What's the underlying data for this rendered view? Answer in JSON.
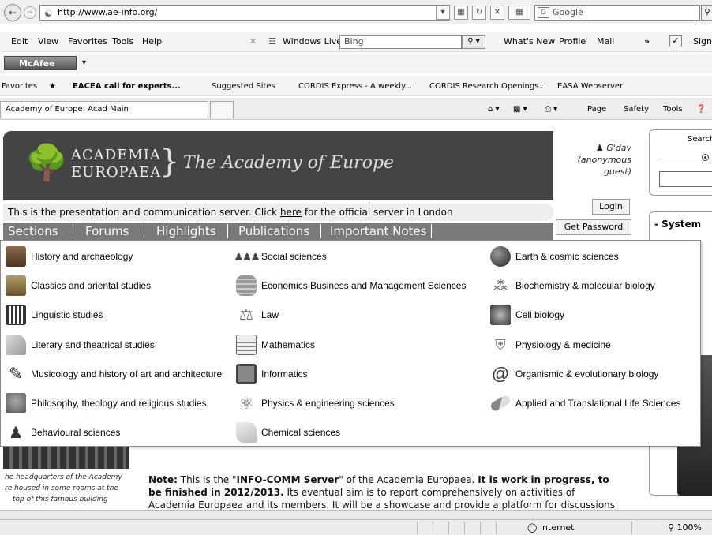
{
  "browser": {
    "url": "http://www.ae-info.org/",
    "search_engine": "Google",
    "menu": [
      "Edit",
      "View",
      "Favorites",
      "Tools",
      "Help"
    ],
    "windows_live": "Windows Live",
    "wl_search_placeholder": "Bing",
    "whats_new": "What's New",
    "profile": "Profile",
    "mail": "Mail",
    "sign": "Sign",
    "mcafee": "McAfee",
    "favorites_label": "Favorites",
    "favorites": [
      "EACEA call for experts...",
      "Suggested Sites",
      "CORDIS Express - A weekly...",
      "CORDIS Research Openings...",
      "EASA Webserver"
    ],
    "tab_title": "Academy of Europe: Acad Main",
    "command_bar": [
      "Page",
      "Safety",
      "Tools"
    ]
  },
  "site": {
    "logo_line1": "ACADEMIA",
    "logo_line2": "EUROPAEA",
    "tagline": "The Academy of Europe",
    "info_text_pre": "This is the presentation and communication server. Click ",
    "info_link": "here",
    "info_text_post": " for the official server in London",
    "sections": [
      "Sections",
      "Forums",
      "Highlights",
      "Publications",
      "Important Notes"
    ],
    "greeting": "G'day (anonymous guest)",
    "login": "Login",
    "get_password": "Get Password",
    "search_label": "Search",
    "system_title": "- System"
  },
  "dropdown": {
    "col1": [
      {
        "label": "History and archaeology",
        "icon": "ruins-icon"
      },
      {
        "label": "Classics and oriental studies",
        "icon": "statue-icon"
      },
      {
        "label": "Linguistic studies",
        "icon": "script-icon"
      },
      {
        "label": "Literary and theatrical studies",
        "icon": "book-icon"
      },
      {
        "label": "Musicology and history of art and architecture",
        "icon": "brush-icon"
      },
      {
        "label": "Philosophy, theology and religious studies",
        "icon": "thinker-icon"
      },
      {
        "label": "Behavioural sciences",
        "icon": "person-icon"
      }
    ],
    "col2": [
      {
        "label": "Social sciences",
        "icon": "crowd-icon"
      },
      {
        "label": "Economics Business and Management Sciences",
        "icon": "coins-icon"
      },
      {
        "label": "Law",
        "icon": "scales-icon"
      },
      {
        "label": "Mathematics",
        "icon": "calculator-icon"
      },
      {
        "label": "Informatics",
        "icon": "computer-icon"
      },
      {
        "label": "Physics & engineering sciences",
        "icon": "atom-icon"
      },
      {
        "label": "Chemical sciences",
        "icon": "flask-icon"
      }
    ],
    "col3": [
      {
        "label": "Earth & cosmic sciences",
        "icon": "globe-icon"
      },
      {
        "label": "Biochemistry & molecular biology",
        "icon": "molecule-icon"
      },
      {
        "label": "Cell biology",
        "icon": "cell-icon"
      },
      {
        "label": "Physiology & medicine",
        "icon": "shield-icon"
      },
      {
        "label": "Organismic & evolutionary biology",
        "icon": "snail-icon"
      },
      {
        "label": "Applied and Translational Life Sciences",
        "icon": "pill-icon"
      }
    ]
  },
  "bottom": {
    "caption1": "he headquarters of the Academy",
    "caption2": "re housed in some rooms at the",
    "caption3": "top of this famous building",
    "note_label": "Note:",
    "note_text1": " This is the \"",
    "note_server": "INFO-COMM Server",
    "note_text2": "\" of the Academia Europaea. ",
    "note_bold": "It is work in progress, to be finished in 2012/2013.",
    "note_text3": " Its eventual aim is to report comprehensively on activities of Academia Europaea and its members. It will be a showcase and provide a platform for discussions for both"
  },
  "status": {
    "zone": "Internet",
    "zoom": "100%"
  }
}
